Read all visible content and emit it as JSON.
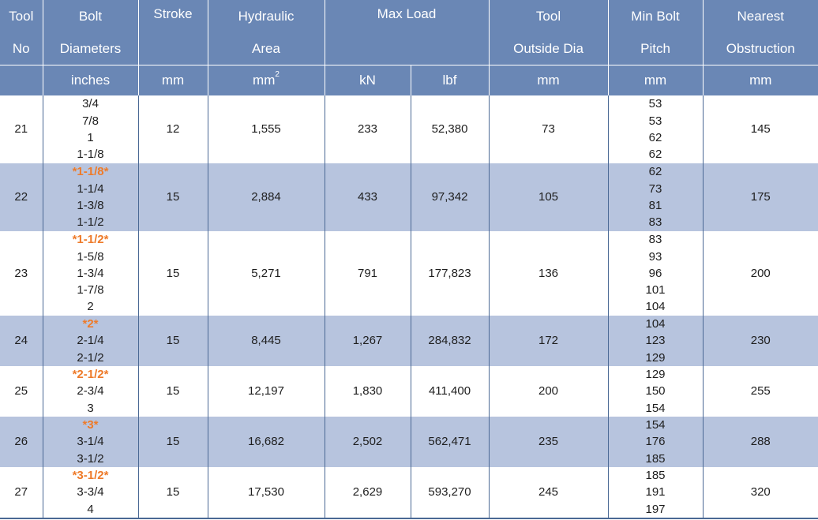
{
  "header": {
    "tool_no": [
      "Tool",
      "No"
    ],
    "bolt_diameters": [
      "Bolt",
      "Diameters"
    ],
    "stroke": "Stroke",
    "hydraulic_area": [
      "Hydraulic",
      "Area"
    ],
    "max_load": "Max Load",
    "tool_outside_dia": [
      "Tool",
      "Outside Dia"
    ],
    "min_bolt_pitch": [
      "Min Bolt",
      "Pitch"
    ],
    "nearest_obstruction": [
      "Nearest",
      "Obstruction"
    ]
  },
  "units": {
    "bolt": "inches",
    "stroke": "mm",
    "area": "mm",
    "area_sup": "2",
    "load_kn": "kN",
    "load_lbf": "lbf",
    "outside_dia": "mm",
    "pitch": "mm",
    "obstruction": "mm"
  },
  "colors": {
    "header_bg": "#6a87b5",
    "alt_row_bg": "#b7c4de",
    "highlight_text": "#ee7b2a",
    "divider": "#4a6894"
  },
  "rows": [
    {
      "tool": "21",
      "bolts": [
        "3/4",
        "7/8",
        "1",
        "1-1/8"
      ],
      "stroke": "12",
      "area": "1,555",
      "kn": "233",
      "lbf": "52,380",
      "dia": "73",
      "pitch": [
        "53",
        "53",
        "62",
        "62"
      ],
      "obstruction": "145"
    },
    {
      "tool": "22",
      "bolts": [
        "*1-1/8*",
        "1-1/4",
        "1-3/8",
        "1-1/2"
      ],
      "stroke": "15",
      "area": "2,884",
      "kn": "433",
      "lbf": "97,342",
      "dia": "105",
      "pitch": [
        "62",
        "73",
        "81",
        "83"
      ],
      "obstruction": "175"
    },
    {
      "tool": "23",
      "bolts": [
        "*1-1/2*",
        "1-5/8",
        "1-3/4",
        "1-7/8",
        "2"
      ],
      "stroke": "15",
      "area": "5,271",
      "kn": "791",
      "lbf": "177,823",
      "dia": "136",
      "pitch": [
        "83",
        "93",
        "96",
        "101",
        "104"
      ],
      "obstruction": "200"
    },
    {
      "tool": "24",
      "bolts": [
        "*2*",
        "2-1/4",
        "2-1/2"
      ],
      "stroke": "15",
      "area": "8,445",
      "kn": "1,267",
      "lbf": "284,832",
      "dia": "172",
      "pitch": [
        "104",
        "123",
        "129"
      ],
      "obstruction": "230"
    },
    {
      "tool": "25",
      "bolts": [
        "*2-1/2*",
        "2-3/4",
        "3"
      ],
      "stroke": "15",
      "area": "12,197",
      "kn": "1,830",
      "lbf": "411,400",
      "dia": "200",
      "pitch": [
        "129",
        "150",
        "154"
      ],
      "obstruction": "255"
    },
    {
      "tool": "26",
      "bolts": [
        "*3*",
        "3-1/4",
        "3-1/2"
      ],
      "stroke": "15",
      "area": "16,682",
      "kn": "2,502",
      "lbf": "562,471",
      "dia": "235",
      "pitch": [
        "154",
        "176",
        "185"
      ],
      "obstruction": "288"
    },
    {
      "tool": "27",
      "bolts": [
        "*3-1/2*",
        "3-3/4",
        "4"
      ],
      "stroke": "15",
      "area": "17,530",
      "kn": "2,629",
      "lbf": "593,270",
      "dia": "245",
      "pitch": [
        "185",
        "191",
        "197"
      ],
      "obstruction": "320"
    }
  ]
}
